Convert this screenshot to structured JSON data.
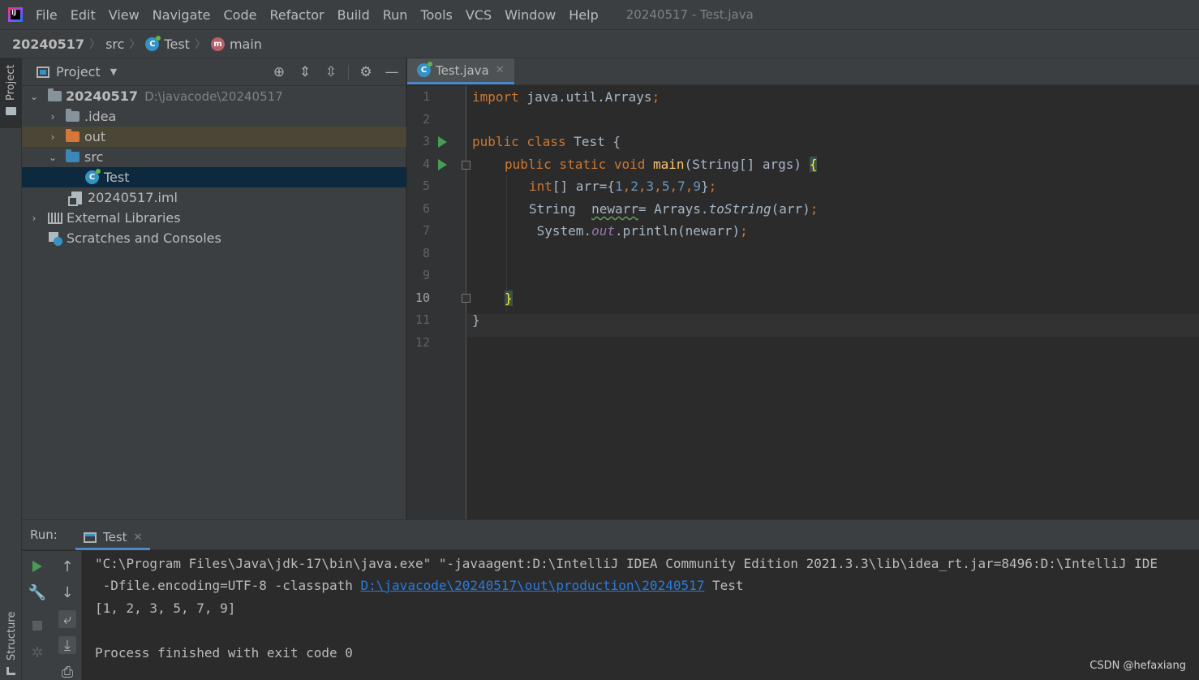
{
  "app": {
    "logo_text": "IJ",
    "window_title": "20240517 - Test.java"
  },
  "menu": [
    {
      "label": "File"
    },
    {
      "label": "Edit"
    },
    {
      "label": "View"
    },
    {
      "label": "Navigate"
    },
    {
      "label": "Code"
    },
    {
      "label": "Refactor"
    },
    {
      "label": "Build"
    },
    {
      "label": "Run"
    },
    {
      "label": "Tools"
    },
    {
      "label": "VCS"
    },
    {
      "label": "Window"
    },
    {
      "label": "Help"
    }
  ],
  "breadcrumb": {
    "project": "20240517",
    "folder": "src",
    "class": "Test",
    "method": "main"
  },
  "left_strip": {
    "project_tab": "Project",
    "structure_tab": "Structure"
  },
  "project_panel": {
    "title": "Project",
    "tree": {
      "root_name": "20240517",
      "root_path": "D:\\javacode\\20240517",
      "idea": ".idea",
      "out": "out",
      "src": "src",
      "test": "Test",
      "iml": "20240517.iml",
      "libraries": "External Libraries",
      "scratches": "Scratches and Consoles"
    }
  },
  "editor": {
    "tab_label": "Test.java",
    "line_numbers": [
      "1",
      "2",
      "3",
      "4",
      "5",
      "6",
      "7",
      "8",
      "9",
      "10",
      "11",
      "12"
    ],
    "code": {
      "l1_kw": "import",
      "l1_rest": " java.util.Arrays",
      "l3_kw": "public class",
      "l3_rest": " Test {",
      "l4_kw": "public static void",
      "l4_fn": "main",
      "l4_rest": "(String[] args) ",
      "l4_brace": "{",
      "l5_kw": "int",
      "l5_a": "[] arr={",
      "l5_nums": [
        "1",
        "2",
        "3",
        "5",
        "7",
        "9"
      ],
      "l5_end": "}",
      "l6_a": "String  ",
      "l6_var": "newarr",
      "l6_b": "= Arrays.",
      "l6_method": "toString",
      "l6_c": "(arr)",
      "l7_a": " System.",
      "l7_field": "out",
      "l7_b": ".println(newarr)",
      "l10_brace": "}",
      "l11": "}",
      "semicolon": ";",
      "comma": ","
    }
  },
  "run_panel": {
    "label": "Run:",
    "tab_label": "Test",
    "console": {
      "line1": "\"C:\\Program Files\\Java\\jdk-17\\bin\\java.exe\" \"-javaagent:D:\\IntelliJ IDEA Community Edition 2021.3.3\\lib\\idea_rt.jar=8496:D:\\IntelliJ IDE",
      "line2_a": " -Dfile.encoding=UTF-8 -classpath ",
      "line2_link": "D:\\javacode\\20240517\\out\\production\\20240517",
      "line2_b": " Test",
      "line3": "[1, 2, 3, 5, 7, 9]",
      "line5": "Process finished with exit code 0"
    }
  },
  "watermark": "CSDN @hefaxiang"
}
